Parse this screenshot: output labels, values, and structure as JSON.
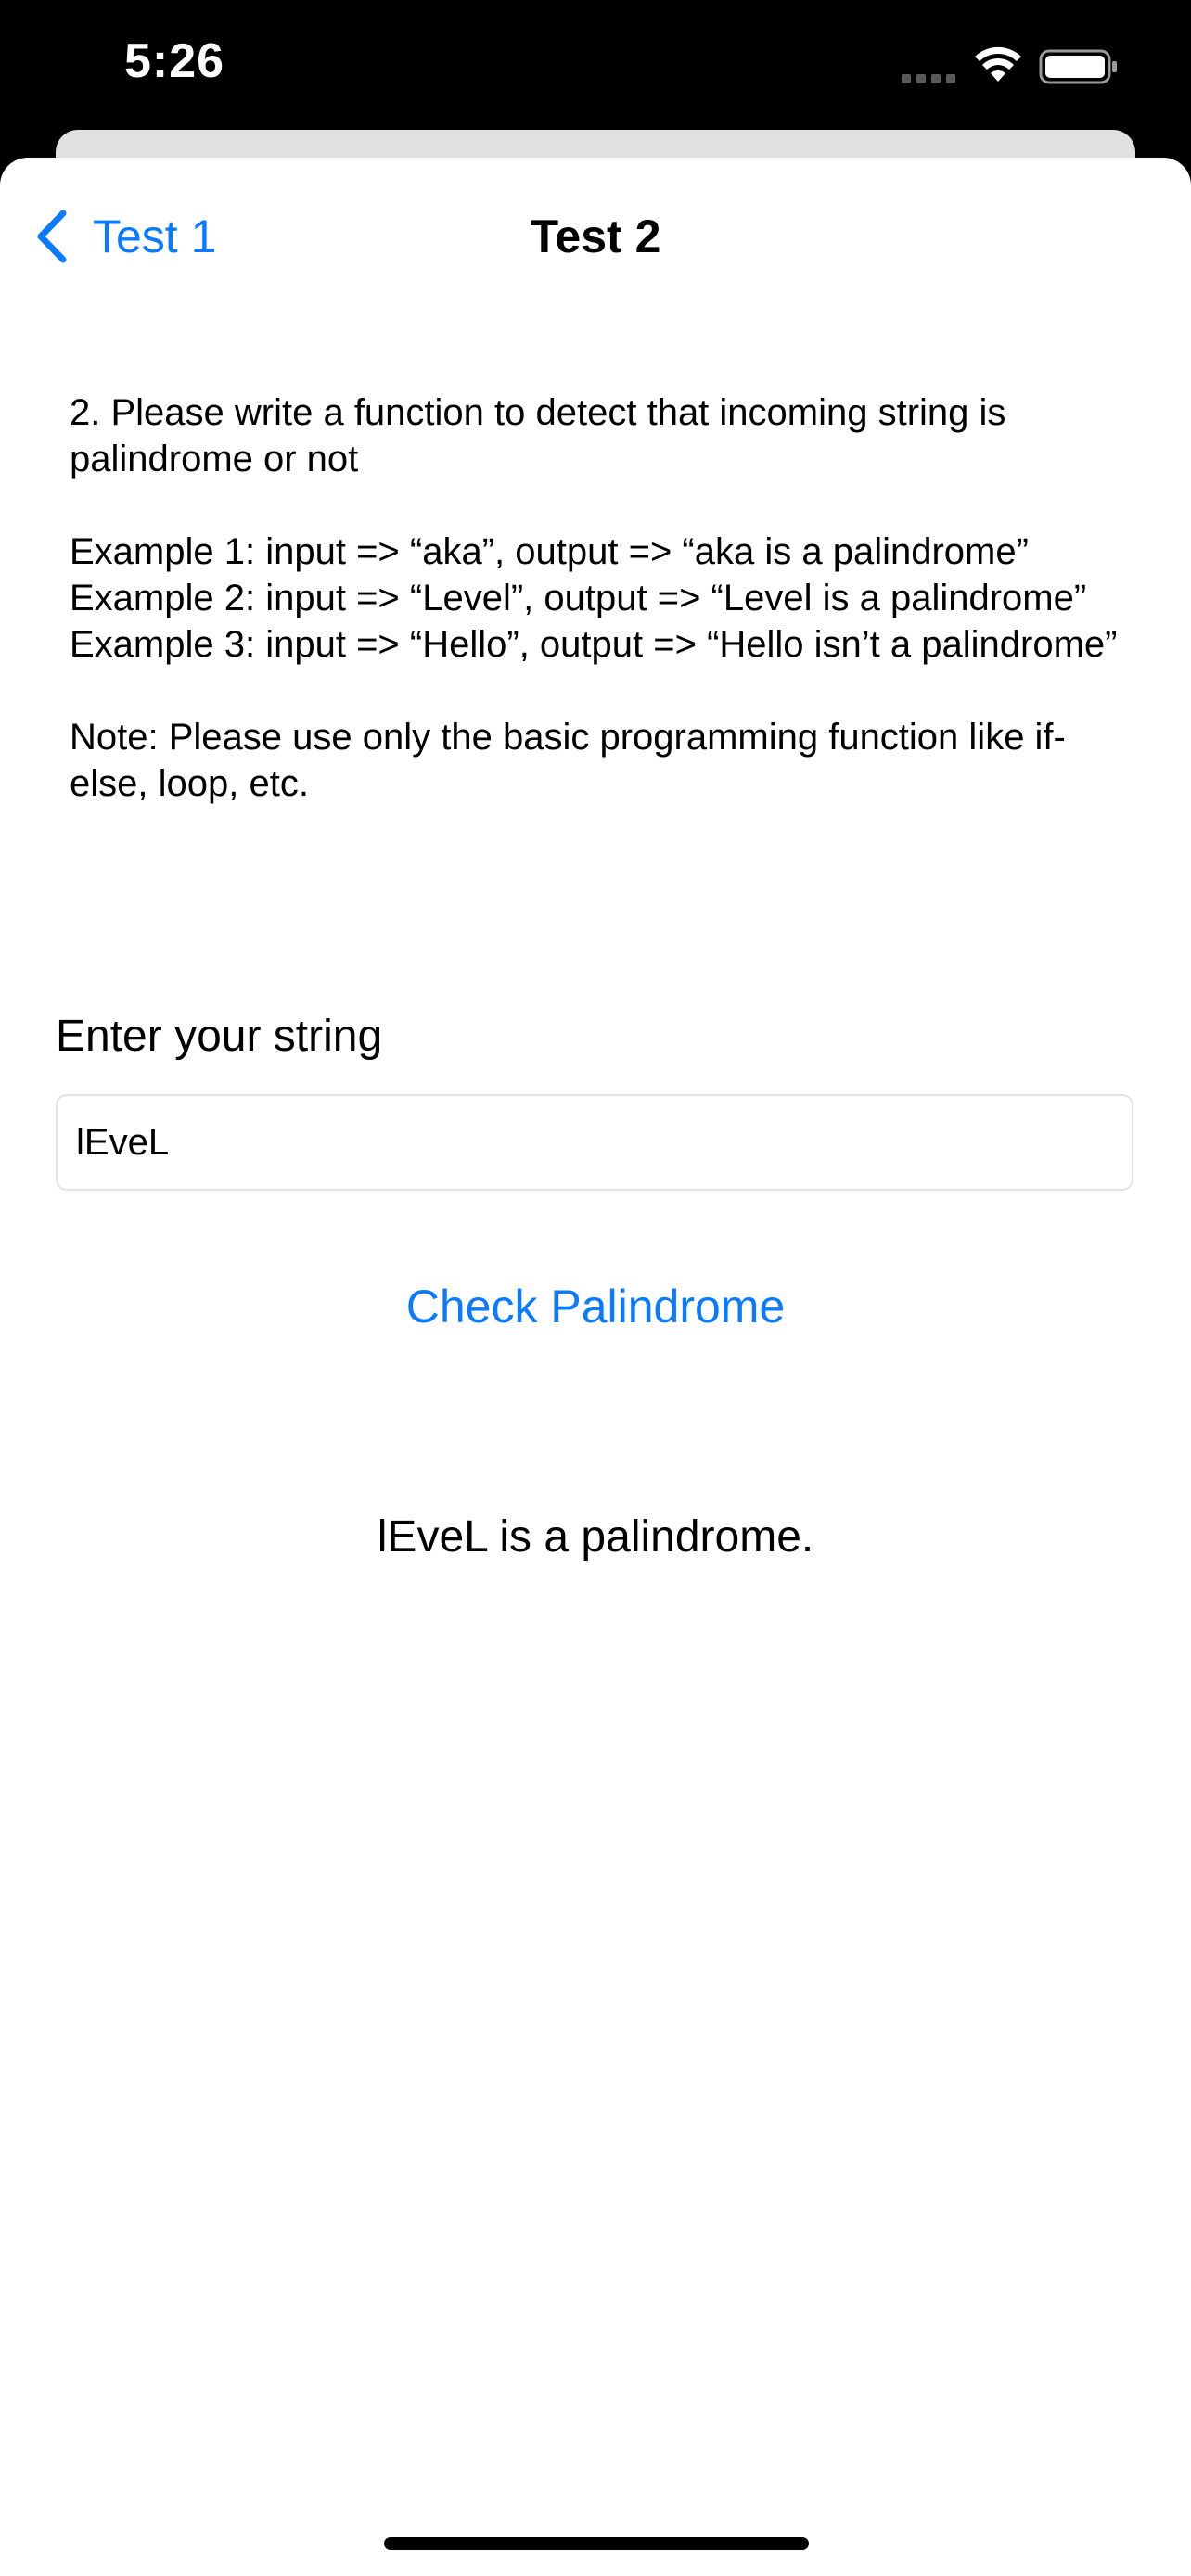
{
  "status_bar": {
    "time": "5:26",
    "icons": [
      "signal-icon",
      "wifi-icon",
      "battery-icon"
    ]
  },
  "nav": {
    "back_label": "Test 1",
    "back_icon": "chevron-left-icon",
    "title": "Test 2"
  },
  "question": {
    "line1": "2. Please write a function to detect that incoming string is palindrome or not",
    "example1": "Example 1: input => “aka”, output => “aka is a palindrome”",
    "example2": "Example 2: input => “Level”, output => “Level is a palindrome”",
    "example3": "Example 3: input => “Hello”, output => “Hello isn’t a palindrome”",
    "note": "Note: Please use only the basic programming function like if-else, loop, etc."
  },
  "form": {
    "label": "Enter your string",
    "input_value": "lEveL",
    "button_label": "Check Palindrome"
  },
  "result": {
    "text": "lEveL is a palindrome."
  },
  "colors": {
    "accent": "#0a7aff",
    "background": "#ffffff",
    "status_bar": "#000000"
  }
}
